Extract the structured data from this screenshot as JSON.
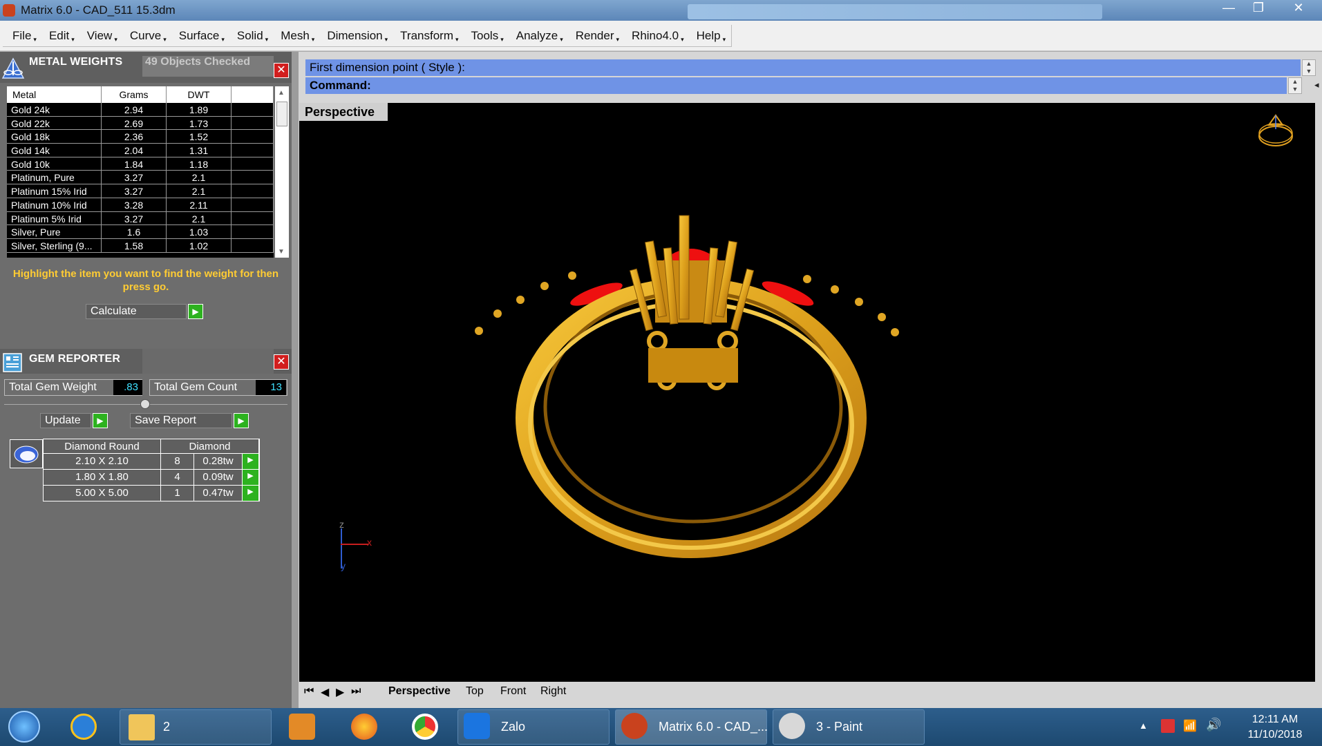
{
  "window": {
    "title": "Matrix 6.0 - CAD_511 15.3dm",
    "min_glyph": "—",
    "restore_glyph": "❐",
    "close_glyph": "✕"
  },
  "menu": [
    "File",
    "Edit",
    "View",
    "Curve",
    "Surface",
    "Solid",
    "Mesh",
    "Dimension",
    "Transform",
    "Tools",
    "Analyze",
    "Render",
    "Rhino4.0",
    "Help"
  ],
  "metal_weights": {
    "title": "METAL WEIGHTS",
    "status": "49 Objects Checked",
    "columns": [
      "Metal",
      "Grams",
      "DWT",
      ""
    ],
    "rows": [
      [
        "Gold 24k",
        "2.94",
        "1.89"
      ],
      [
        "Gold 22k",
        "2.69",
        "1.73"
      ],
      [
        "Gold 18k",
        "2.36",
        "1.52"
      ],
      [
        "Gold 14k",
        "2.04",
        "1.31"
      ],
      [
        "Gold 10k",
        "1.84",
        "1.18"
      ],
      [
        "Platinum, Pure",
        "3.27",
        "2.1"
      ],
      [
        "Platinum 15% Irid",
        "3.27",
        "2.1"
      ],
      [
        "Platinum 10% Irid",
        "3.28",
        "2.11"
      ],
      [
        "Platinum 5% Irid",
        "3.27",
        "2.1"
      ],
      [
        "Silver, Pure",
        "1.6",
        "1.03"
      ],
      [
        "Silver, Sterling (9...",
        "1.58",
        "1.02"
      ]
    ],
    "hint": "Highlight the item you want to find the weight for then press go.",
    "calculate_label": "Calculate"
  },
  "gem_reporter": {
    "title": "GEM REPORTER",
    "total_weight_label": "Total Gem Weight",
    "total_weight_value": ".83",
    "total_count_label": "Total Gem Count",
    "total_count_value": "13",
    "update_label": "Update",
    "save_label": "Save Report",
    "table_header": [
      "Diamond Round",
      "Diamond"
    ],
    "rows": [
      [
        "2.10 X 2.10",
        "8",
        "0.28tw"
      ],
      [
        "1.80 X 1.80",
        "4",
        "0.09tw"
      ],
      [
        "5.00 X 5.00",
        "1",
        "0.47tw"
      ]
    ]
  },
  "command": {
    "prompt_line": "First dimension point ( Style ):",
    "command_label": "Command:"
  },
  "viewport": {
    "label": "Perspective",
    "axis_z": "z",
    "axis_x": "x",
    "axis_y": "y",
    "band_color": "#e0a020",
    "gem_color": "#ee1010"
  },
  "view_tabs": [
    "Perspective",
    "Top",
    "Front",
    "Right"
  ],
  "taskbar": {
    "folder_count": "2",
    "zalo_label": "Zalo",
    "matrix_label": "Matrix 6.0 - CAD_...",
    "paint_label": "3 - Paint",
    "time": "12:11 AM",
    "date": "11/10/2018"
  }
}
